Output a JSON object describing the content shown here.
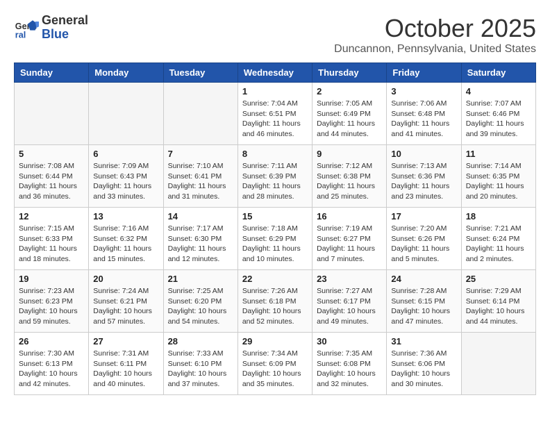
{
  "header": {
    "logo_general": "General",
    "logo_blue": "Blue",
    "month_title": "October 2025",
    "subtitle": "Duncannon, Pennsylvania, United States"
  },
  "days_of_week": [
    "Sunday",
    "Monday",
    "Tuesday",
    "Wednesday",
    "Thursday",
    "Friday",
    "Saturday"
  ],
  "weeks": [
    [
      {
        "day": "",
        "info": ""
      },
      {
        "day": "",
        "info": ""
      },
      {
        "day": "",
        "info": ""
      },
      {
        "day": "1",
        "info": "Sunrise: 7:04 AM\nSunset: 6:51 PM\nDaylight: 11 hours and 46 minutes."
      },
      {
        "day": "2",
        "info": "Sunrise: 7:05 AM\nSunset: 6:49 PM\nDaylight: 11 hours and 44 minutes."
      },
      {
        "day": "3",
        "info": "Sunrise: 7:06 AM\nSunset: 6:48 PM\nDaylight: 11 hours and 41 minutes."
      },
      {
        "day": "4",
        "info": "Sunrise: 7:07 AM\nSunset: 6:46 PM\nDaylight: 11 hours and 39 minutes."
      }
    ],
    [
      {
        "day": "5",
        "info": "Sunrise: 7:08 AM\nSunset: 6:44 PM\nDaylight: 11 hours and 36 minutes."
      },
      {
        "day": "6",
        "info": "Sunrise: 7:09 AM\nSunset: 6:43 PM\nDaylight: 11 hours and 33 minutes."
      },
      {
        "day": "7",
        "info": "Sunrise: 7:10 AM\nSunset: 6:41 PM\nDaylight: 11 hours and 31 minutes."
      },
      {
        "day": "8",
        "info": "Sunrise: 7:11 AM\nSunset: 6:39 PM\nDaylight: 11 hours and 28 minutes."
      },
      {
        "day": "9",
        "info": "Sunrise: 7:12 AM\nSunset: 6:38 PM\nDaylight: 11 hours and 25 minutes."
      },
      {
        "day": "10",
        "info": "Sunrise: 7:13 AM\nSunset: 6:36 PM\nDaylight: 11 hours and 23 minutes."
      },
      {
        "day": "11",
        "info": "Sunrise: 7:14 AM\nSunset: 6:35 PM\nDaylight: 11 hours and 20 minutes."
      }
    ],
    [
      {
        "day": "12",
        "info": "Sunrise: 7:15 AM\nSunset: 6:33 PM\nDaylight: 11 hours and 18 minutes."
      },
      {
        "day": "13",
        "info": "Sunrise: 7:16 AM\nSunset: 6:32 PM\nDaylight: 11 hours and 15 minutes."
      },
      {
        "day": "14",
        "info": "Sunrise: 7:17 AM\nSunset: 6:30 PM\nDaylight: 11 hours and 12 minutes."
      },
      {
        "day": "15",
        "info": "Sunrise: 7:18 AM\nSunset: 6:29 PM\nDaylight: 11 hours and 10 minutes."
      },
      {
        "day": "16",
        "info": "Sunrise: 7:19 AM\nSunset: 6:27 PM\nDaylight: 11 hours and 7 minutes."
      },
      {
        "day": "17",
        "info": "Sunrise: 7:20 AM\nSunset: 6:26 PM\nDaylight: 11 hours and 5 minutes."
      },
      {
        "day": "18",
        "info": "Sunrise: 7:21 AM\nSunset: 6:24 PM\nDaylight: 11 hours and 2 minutes."
      }
    ],
    [
      {
        "day": "19",
        "info": "Sunrise: 7:23 AM\nSunset: 6:23 PM\nDaylight: 10 hours and 59 minutes."
      },
      {
        "day": "20",
        "info": "Sunrise: 7:24 AM\nSunset: 6:21 PM\nDaylight: 10 hours and 57 minutes."
      },
      {
        "day": "21",
        "info": "Sunrise: 7:25 AM\nSunset: 6:20 PM\nDaylight: 10 hours and 54 minutes."
      },
      {
        "day": "22",
        "info": "Sunrise: 7:26 AM\nSunset: 6:18 PM\nDaylight: 10 hours and 52 minutes."
      },
      {
        "day": "23",
        "info": "Sunrise: 7:27 AM\nSunset: 6:17 PM\nDaylight: 10 hours and 49 minutes."
      },
      {
        "day": "24",
        "info": "Sunrise: 7:28 AM\nSunset: 6:15 PM\nDaylight: 10 hours and 47 minutes."
      },
      {
        "day": "25",
        "info": "Sunrise: 7:29 AM\nSunset: 6:14 PM\nDaylight: 10 hours and 44 minutes."
      }
    ],
    [
      {
        "day": "26",
        "info": "Sunrise: 7:30 AM\nSunset: 6:13 PM\nDaylight: 10 hours and 42 minutes."
      },
      {
        "day": "27",
        "info": "Sunrise: 7:31 AM\nSunset: 6:11 PM\nDaylight: 10 hours and 40 minutes."
      },
      {
        "day": "28",
        "info": "Sunrise: 7:33 AM\nSunset: 6:10 PM\nDaylight: 10 hours and 37 minutes."
      },
      {
        "day": "29",
        "info": "Sunrise: 7:34 AM\nSunset: 6:09 PM\nDaylight: 10 hours and 35 minutes."
      },
      {
        "day": "30",
        "info": "Sunrise: 7:35 AM\nSunset: 6:08 PM\nDaylight: 10 hours and 32 minutes."
      },
      {
        "day": "31",
        "info": "Sunrise: 7:36 AM\nSunset: 6:06 PM\nDaylight: 10 hours and 30 minutes."
      },
      {
        "day": "",
        "info": ""
      }
    ]
  ]
}
